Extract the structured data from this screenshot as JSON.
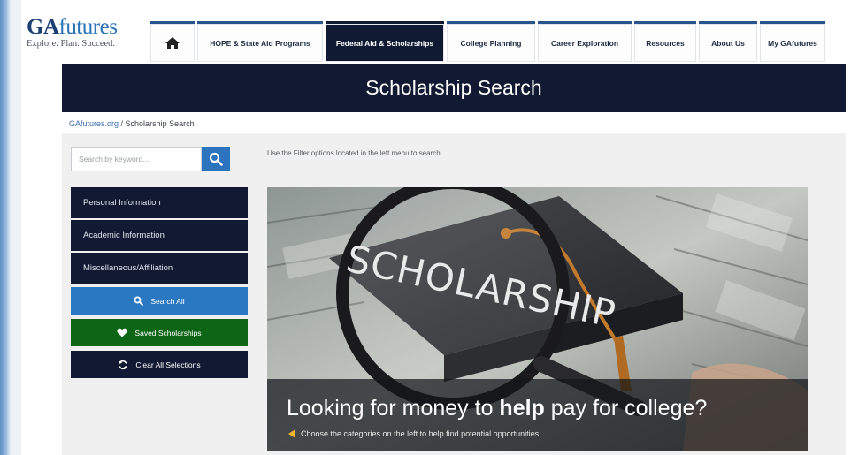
{
  "logo": {
    "brand_bold": "GA",
    "brand_light": "futures",
    "tagline": "Explore. Plan. Succeed."
  },
  "nav": {
    "home_icon": "home-icon",
    "tabs": [
      {
        "label": "HOPE & State Aid Programs",
        "active": false
      },
      {
        "label": "Federal Aid & Scholarships",
        "active": true
      },
      {
        "label": "College Planning",
        "active": false
      },
      {
        "label": "Career Exploration",
        "active": false
      },
      {
        "label": "Resources",
        "active": false
      },
      {
        "label": "About Us",
        "active": false
      },
      {
        "label": "My GAfutures",
        "active": false
      }
    ]
  },
  "banner": {
    "title": "Scholarship Search"
  },
  "breadcrumb": {
    "home": "GAfutures.org",
    "separator": " / ",
    "current": "Scholarship Search"
  },
  "search": {
    "placeholder": "Search by keyword...",
    "button_icon": "search-icon",
    "instructions": "Use the Filter options located in the left menu to search."
  },
  "sidebar": {
    "filters": [
      {
        "label": "Personal Information"
      },
      {
        "label": "Academic Information"
      },
      {
        "label": "Miscellaneous/Affiliation"
      }
    ],
    "search_all": "Search All",
    "saved": "Saved Scholarships",
    "clear": "Clear All Selections"
  },
  "hero": {
    "image_text": "SCHOLARSHIP",
    "headline_pre": "Looking for money to ",
    "headline_bold": "help",
    "headline_post": " pay for college?",
    "subtext": "Choose the categories on the left to help find potential opportunities"
  },
  "colors": {
    "navy": "#111a32",
    "accent_blue": "#2b78c2",
    "green": "#0d6516",
    "arrow": "#f3b42a"
  }
}
